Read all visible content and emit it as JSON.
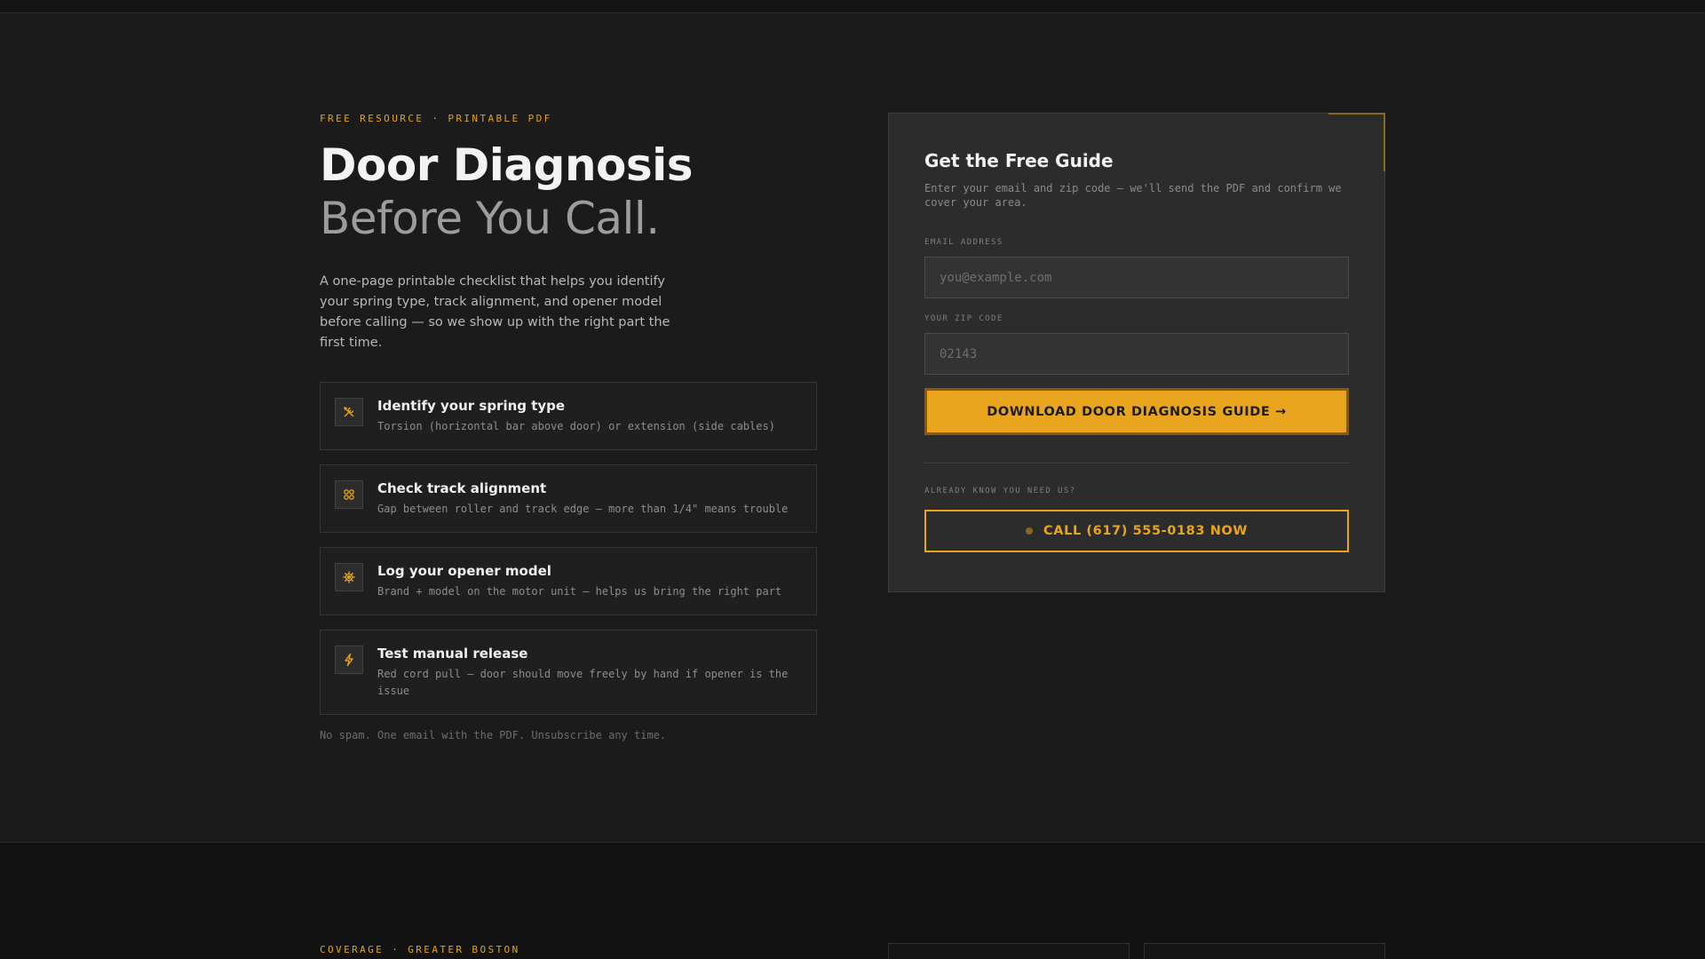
{
  "hero": {
    "eyebrow": "FREE RESOURCE · PRINTABLE PDF",
    "title_line1": "Door Diagnosis",
    "title_line2": "Before You Call.",
    "lead": "A one-page printable checklist that helps you identify your spring type, track alignment, and opener model before calling — so we show up with the right part the first time."
  },
  "features": [
    {
      "icon": "wrench-icon",
      "title": "Identify your spring type",
      "desc": "Torsion (horizontal bar above door) or extension (side cables)"
    },
    {
      "icon": "grid-icon",
      "title": "Check track alignment",
      "desc": "Gap between roller and track edge — more than 1/4\" means trouble"
    },
    {
      "icon": "gear-icon",
      "title": "Log your opener model",
      "desc": "Brand + model on the motor unit — helps us bring the right part"
    },
    {
      "icon": "lightning-icon",
      "title": "Test manual release",
      "desc": "Red cord pull — door should move freely by hand if opener is the issue"
    }
  ],
  "disclaimer": "No spam. One email with the PDF. Unsubscribe any time.",
  "form": {
    "title": "Get the Free Guide",
    "subtitle": "Enter your email and zip code — we'll send the PDF and confirm we cover your area.",
    "email_label": "EMAIL ADDRESS",
    "email_placeholder": "you@example.com",
    "email_value": "",
    "zip_label": "YOUR ZIP CODE",
    "zip_placeholder": "02143",
    "zip_value": "",
    "submit_label": "DOWNLOAD DOOR DIAGNOSIS GUIDE →",
    "already_label": "ALREADY KNOW YOU NEED US?",
    "call_label": "CALL (617) 555-0183 NOW"
  },
  "coverage": {
    "eyebrow": "COVERAGE · GREATER BOSTON"
  },
  "colors": {
    "accent": "#e8a51d",
    "background": "#1b1b1b",
    "card": "#2c2c2c"
  }
}
